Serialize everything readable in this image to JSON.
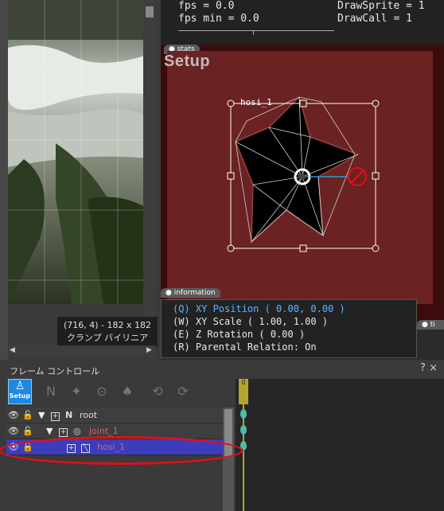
{
  "stats": {
    "fps": "fps = 0.0",
    "fps_min": "fps min = 0.0",
    "draw_sprite": "DrawSprite = 1",
    "draw_call": "DrawCall = 1"
  },
  "scene": {
    "tab_stats": "stats",
    "mode_title": "Setup",
    "object_label": "hosi_1",
    "tab_information": "information",
    "tab_tl": "ti"
  },
  "image_panel": {
    "coords": "(716, 4) - 182 x 182",
    "mode": "クランプ バイリニア"
  },
  "info": {
    "line1": "(Q) XY Position ( 0.00, 0.00 )",
    "line2": "(W) XY Scale ( 1.00, 1.00 )",
    "line3": "(E) Z Rotation ( 0.00 )",
    "line4": "(R) Parental Relation: On"
  },
  "frame_control": {
    "title": "フレーム コントロール",
    "help": "?",
    "close": "×",
    "setup_label": "Setup",
    "frame_number": "0",
    "tree": [
      {
        "name": "root"
      },
      {
        "name": "joint_1"
      },
      {
        "name": "hosi_1"
      }
    ]
  },
  "colors": {
    "accent": "#1e88e5",
    "selection": "#3b3dbd",
    "highlight_ellipse": "#e0101a",
    "info_selected": "#5fb3ff"
  }
}
